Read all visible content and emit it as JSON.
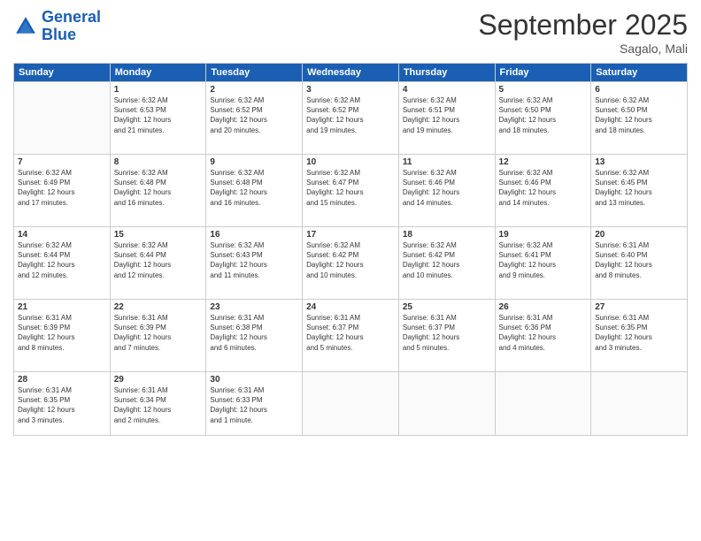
{
  "header": {
    "logo_line1": "General",
    "logo_line2": "Blue",
    "month": "September 2025",
    "location": "Sagalo, Mali"
  },
  "days_of_week": [
    "Sunday",
    "Monday",
    "Tuesday",
    "Wednesday",
    "Thursday",
    "Friday",
    "Saturday"
  ],
  "weeks": [
    [
      {
        "day": "",
        "info": ""
      },
      {
        "day": "1",
        "info": "Sunrise: 6:32 AM\nSunset: 6:53 PM\nDaylight: 12 hours\nand 21 minutes."
      },
      {
        "day": "2",
        "info": "Sunrise: 6:32 AM\nSunset: 6:52 PM\nDaylight: 12 hours\nand 20 minutes."
      },
      {
        "day": "3",
        "info": "Sunrise: 6:32 AM\nSunset: 6:52 PM\nDaylight: 12 hours\nand 19 minutes."
      },
      {
        "day": "4",
        "info": "Sunrise: 6:32 AM\nSunset: 6:51 PM\nDaylight: 12 hours\nand 19 minutes."
      },
      {
        "day": "5",
        "info": "Sunrise: 6:32 AM\nSunset: 6:50 PM\nDaylight: 12 hours\nand 18 minutes."
      },
      {
        "day": "6",
        "info": "Sunrise: 6:32 AM\nSunset: 6:50 PM\nDaylight: 12 hours\nand 18 minutes."
      }
    ],
    [
      {
        "day": "7",
        "info": "Sunrise: 6:32 AM\nSunset: 6:49 PM\nDaylight: 12 hours\nand 17 minutes."
      },
      {
        "day": "8",
        "info": "Sunrise: 6:32 AM\nSunset: 6:48 PM\nDaylight: 12 hours\nand 16 minutes."
      },
      {
        "day": "9",
        "info": "Sunrise: 6:32 AM\nSunset: 6:48 PM\nDaylight: 12 hours\nand 16 minutes."
      },
      {
        "day": "10",
        "info": "Sunrise: 6:32 AM\nSunset: 6:47 PM\nDaylight: 12 hours\nand 15 minutes."
      },
      {
        "day": "11",
        "info": "Sunrise: 6:32 AM\nSunset: 6:46 PM\nDaylight: 12 hours\nand 14 minutes."
      },
      {
        "day": "12",
        "info": "Sunrise: 6:32 AM\nSunset: 6:46 PM\nDaylight: 12 hours\nand 14 minutes."
      },
      {
        "day": "13",
        "info": "Sunrise: 6:32 AM\nSunset: 6:45 PM\nDaylight: 12 hours\nand 13 minutes."
      }
    ],
    [
      {
        "day": "14",
        "info": "Sunrise: 6:32 AM\nSunset: 6:44 PM\nDaylight: 12 hours\nand 12 minutes."
      },
      {
        "day": "15",
        "info": "Sunrise: 6:32 AM\nSunset: 6:44 PM\nDaylight: 12 hours\nand 12 minutes."
      },
      {
        "day": "16",
        "info": "Sunrise: 6:32 AM\nSunset: 6:43 PM\nDaylight: 12 hours\nand 11 minutes."
      },
      {
        "day": "17",
        "info": "Sunrise: 6:32 AM\nSunset: 6:42 PM\nDaylight: 12 hours\nand 10 minutes."
      },
      {
        "day": "18",
        "info": "Sunrise: 6:32 AM\nSunset: 6:42 PM\nDaylight: 12 hours\nand 10 minutes."
      },
      {
        "day": "19",
        "info": "Sunrise: 6:32 AM\nSunset: 6:41 PM\nDaylight: 12 hours\nand 9 minutes."
      },
      {
        "day": "20",
        "info": "Sunrise: 6:31 AM\nSunset: 6:40 PM\nDaylight: 12 hours\nand 8 minutes."
      }
    ],
    [
      {
        "day": "21",
        "info": "Sunrise: 6:31 AM\nSunset: 6:39 PM\nDaylight: 12 hours\nand 8 minutes."
      },
      {
        "day": "22",
        "info": "Sunrise: 6:31 AM\nSunset: 6:39 PM\nDaylight: 12 hours\nand 7 minutes."
      },
      {
        "day": "23",
        "info": "Sunrise: 6:31 AM\nSunset: 6:38 PM\nDaylight: 12 hours\nand 6 minutes."
      },
      {
        "day": "24",
        "info": "Sunrise: 6:31 AM\nSunset: 6:37 PM\nDaylight: 12 hours\nand 5 minutes."
      },
      {
        "day": "25",
        "info": "Sunrise: 6:31 AM\nSunset: 6:37 PM\nDaylight: 12 hours\nand 5 minutes."
      },
      {
        "day": "26",
        "info": "Sunrise: 6:31 AM\nSunset: 6:36 PM\nDaylight: 12 hours\nand 4 minutes."
      },
      {
        "day": "27",
        "info": "Sunrise: 6:31 AM\nSunset: 6:35 PM\nDaylight: 12 hours\nand 3 minutes."
      }
    ],
    [
      {
        "day": "28",
        "info": "Sunrise: 6:31 AM\nSunset: 6:35 PM\nDaylight: 12 hours\nand 3 minutes."
      },
      {
        "day": "29",
        "info": "Sunrise: 6:31 AM\nSunset: 6:34 PM\nDaylight: 12 hours\nand 2 minutes."
      },
      {
        "day": "30",
        "info": "Sunrise: 6:31 AM\nSunset: 6:33 PM\nDaylight: 12 hours\nand 1 minute."
      },
      {
        "day": "",
        "info": ""
      },
      {
        "day": "",
        "info": ""
      },
      {
        "day": "",
        "info": ""
      },
      {
        "day": "",
        "info": ""
      }
    ]
  ]
}
